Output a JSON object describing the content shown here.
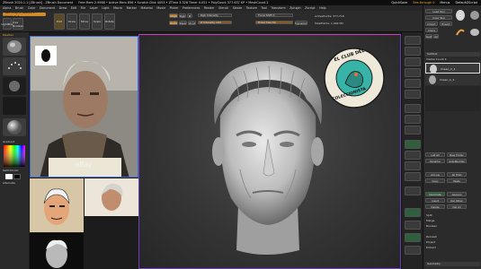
{
  "window": {
    "title": "ZBrush 2020.1.1 [ZBrush] - ZBrush Document",
    "stats": "Free Mem 2.9968 • Active Mem 856 • Scratch Disk 4053 • ZTime 3.328 Timer 0.051 • PolyCount 377.637 KP • MeshCount 2",
    "quicksave": "QuickSave",
    "interface": "See-through 0",
    "menus_label": "Menus",
    "defaultscript": "DefaultZScript"
  },
  "menu": [
    "Alpha",
    "Brush",
    "Color",
    "Document",
    "Draw",
    "Edit",
    "File",
    "Layer",
    "Light",
    "Macro",
    "Marker",
    "Material",
    "Movie",
    "Picker",
    "Preferences",
    "Render",
    "Stencil",
    "Stroke",
    "Texture",
    "Tool",
    "Transform",
    "Zplugin",
    "Zscript",
    "Help"
  ],
  "toolbar": {
    "switching": "Switching to Subtool 1 - Imean_C_1",
    "mrgb": "Mrgb",
    "rgb": "Rgb",
    "m": "M",
    "zadd": "Zadd",
    "zsub": "Zsub",
    "zcut": "Zcut",
    "rgb_intensity": "Rgb Intensity",
    "z_intensity": "Z Intensity 100",
    "focal_shift": "Focal Shift 0",
    "draw_size": "Draw Size 64",
    "dynamic": "Dynamic",
    "active_points": "ActivePoints: 377,718",
    "total_points": "TotalPoints: 1.992 Mil",
    "lightbox": "LightBox",
    "live_boolean": "Live Boolean",
    "edit": "Edit",
    "draw": "Draw",
    "move": "Move",
    "scale": "Scale",
    "rotate": "Rotate"
  },
  "left": {
    "palettes": "Palettes",
    "lightbox_label": "LightBox",
    "gradient": "Gradient",
    "switch_color": "SwitchColor",
    "alternate": "Alternate"
  },
  "reference": {
    "watermark": "eBay"
  },
  "logo": {
    "top_text": "EL CLUB DEL",
    "bottom_text": "COLECCIONISTA"
  },
  "right_tools": {
    "tool_label": "Tool",
    "load_tool": "Load Tool",
    "save_as": "Save As",
    "copy_tool": "Copy Tool",
    "paste_tool": "Paste Tool",
    "import": "Import",
    "export": "Export",
    "clone": "Clone",
    "make_polymesh": "Make PolyMesh3D",
    "goz": "GoZ",
    "all": "All",
    "visible": "Visible",
    "r": "R",
    "lightbox_tools": "Lightbox > Tools",
    "imean_name": "Imean_C_1 . 48",
    "subtool": "Subtool",
    "visible_count": "Visible Count 2",
    "subtool_items": [
      "Imean_C_1",
      "Imean_C_2"
    ],
    "list_all": "List All",
    "new_folder": "New Folder",
    "rename": "Rename",
    "auto_reorder": "AutoReorder",
    "all_low": "All Low",
    "all_high": "All High",
    "copy": "Copy",
    "paste": "Paste",
    "duplicate": "Duplicate",
    "append": "Append",
    "insert": "Insert",
    "del_other": "Del Other",
    "delete": "Delete",
    "del_all": "Del All",
    "split": "Split",
    "merge": "Merge",
    "boolean": "Boolean",
    "remesh": "Remesh",
    "project": "Project",
    "extract": "Extract",
    "geometry": "Geometry",
    "array_mesh": "ArrayMesh",
    "nanomesh": "NanoMesh",
    "layers": "Layers",
    "fibermesh": "FiberMesh"
  },
  "colors": {
    "accent_orange": "#d28a2a",
    "frame_blue": "#3f6bd8",
    "viewport_frame": "#d03fb8",
    "logo_teal": "#37b3a8"
  }
}
